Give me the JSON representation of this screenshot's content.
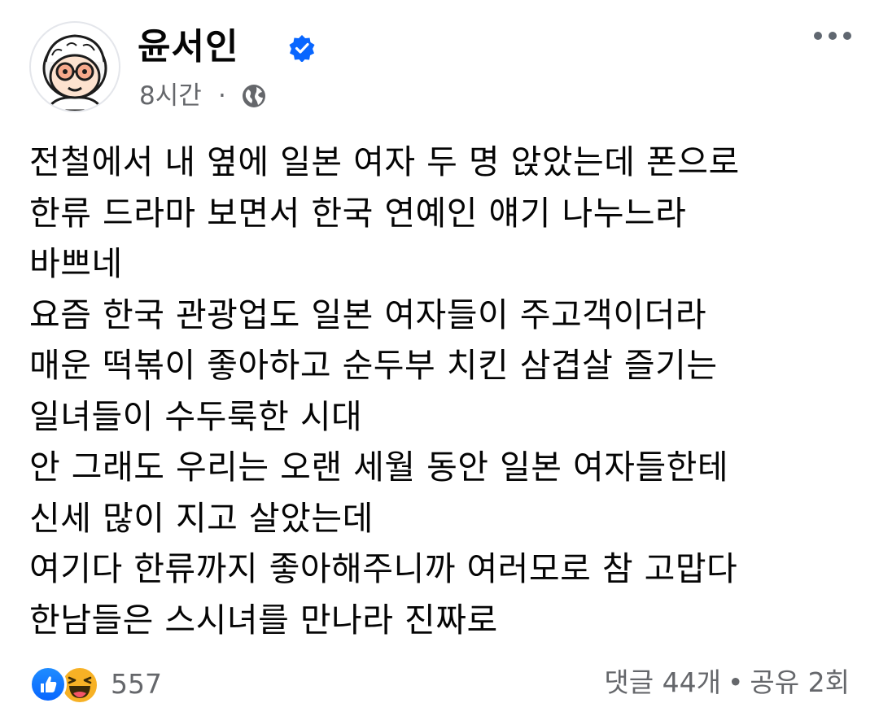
{
  "post": {
    "author": {
      "name": "윤서인",
      "verified": true,
      "avatar_icon": "cartoon-avatar-icon"
    },
    "meta": {
      "time": "8시간",
      "separator": "·",
      "audience_icon": "globe-icon"
    },
    "more_icon": "more-options-icon",
    "lines": [
      "전철에서 내 옆에 일본 여자 두 명 앉았는데 폰으로",
      "한류 드라마 보면서 한국 연예인 얘기 나누느라",
      "바쁘네",
      "요즘 한국 관광업도 일본 여자들이 주고객이더라",
      "매운 떡볶이 좋아하고 순두부 치킨 삼겹살 즐기는",
      "일녀들이 수두룩한 시대",
      "안 그래도 우리는 오랜 세월 동안 일본 여자들한테",
      "신세 많이 지고 살았는데",
      "여기다 한류까지 좋아해주니까 여러모로 참 고맙다",
      "한남들은 스시녀를 만나라 진짜로"
    ],
    "reactions": {
      "icons": [
        "like-icon",
        "haha-icon"
      ],
      "count": "557"
    },
    "stats": {
      "comments": "댓글 44개",
      "separator": "•",
      "shares": "공유 2회"
    },
    "colors": {
      "text": "#050505",
      "secondary": "#65676b",
      "verified_blue": "#0866ff",
      "like_blue": "#0866ff",
      "haha_yellow": "#f7b125"
    }
  }
}
